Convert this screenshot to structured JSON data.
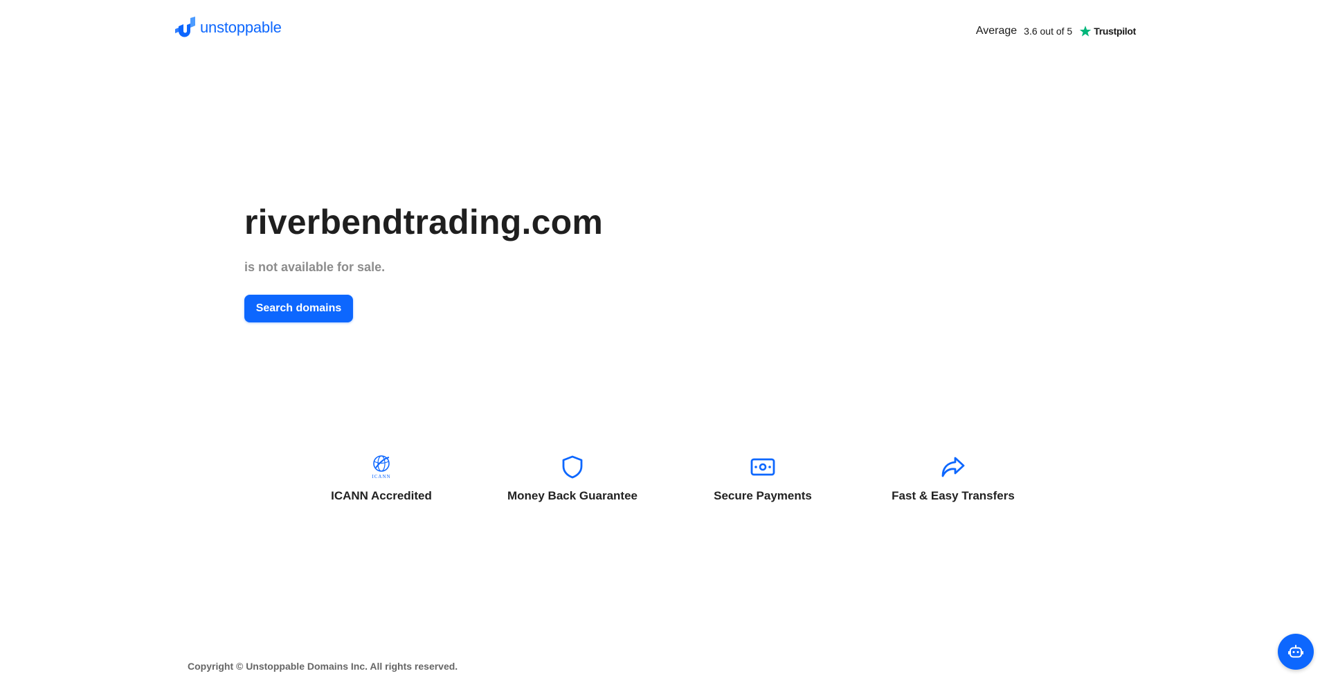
{
  "header": {
    "brand": "unstoppable",
    "rating": {
      "label": "Average",
      "score": "3.6 out of 5",
      "provider": "Trustpilot",
      "star_color": "#00b67a"
    }
  },
  "hero": {
    "domain": "riverbendtrading.com",
    "status": "is not available for sale.",
    "search_button": "Search domains"
  },
  "features": [
    {
      "label": "ICANN Accredited",
      "icon": "icann-logo-icon",
      "icon_text": "ICANN"
    },
    {
      "label": "Money Back Guarantee",
      "icon": "shield-icon"
    },
    {
      "label": "Secure Payments",
      "icon": "cash-icon"
    },
    {
      "label": "Fast & Easy Transfers",
      "icon": "share-arrow-icon"
    }
  ],
  "footer": {
    "copyright": "Copyright © Unstoppable Domains Inc. All rights reserved."
  },
  "chat": {
    "icon": "bot-icon"
  },
  "colors": {
    "accent": "#0d67fe",
    "heading": "#1f1f1f",
    "muted": "#8c8c8c",
    "footer_text": "#666666"
  }
}
